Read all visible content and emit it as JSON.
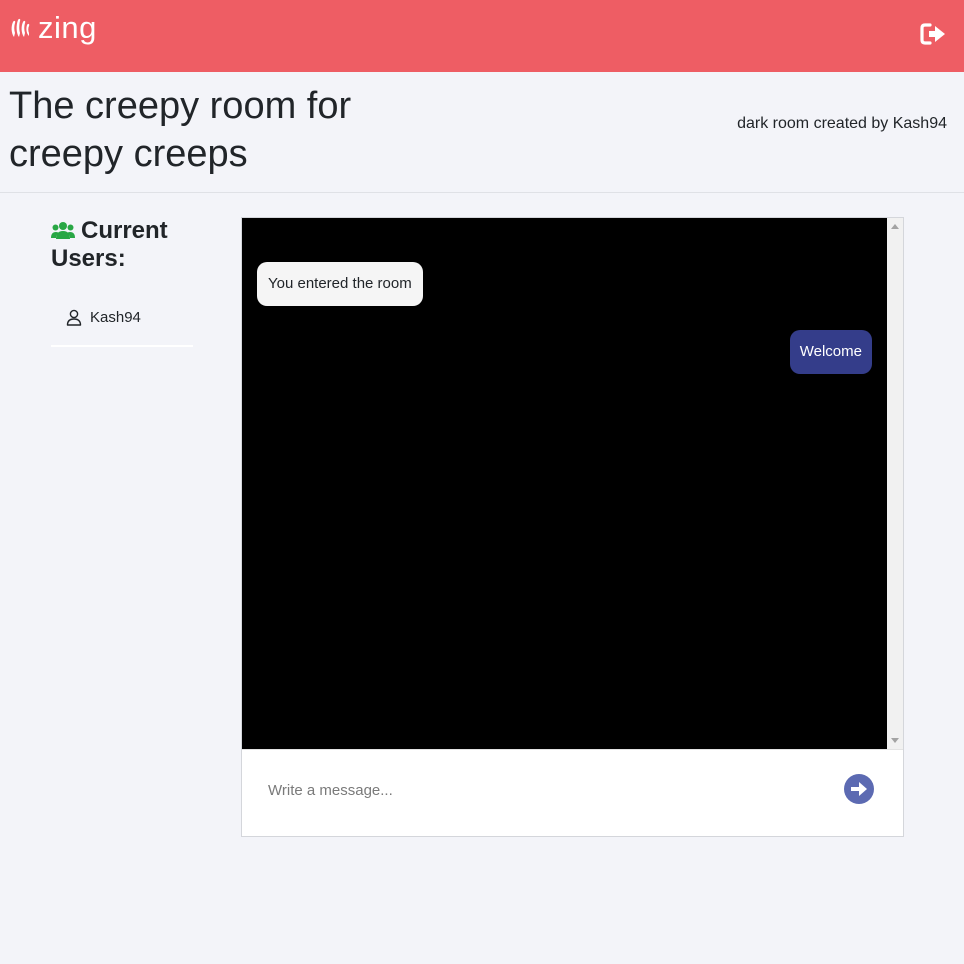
{
  "app": {
    "name": "zing"
  },
  "room": {
    "title": "The creepy room for creepy creeps",
    "theme": "dark",
    "created_by_text": "room created by",
    "creator": "Kash94"
  },
  "users_panel": {
    "heading": "Current Users:",
    "users": [
      {
        "name": "Kash94"
      }
    ]
  },
  "chat": {
    "messages": [
      {
        "direction": "incoming",
        "text": "You entered the room"
      },
      {
        "direction": "outgoing",
        "text": "Welcome"
      }
    ],
    "input_placeholder": "Write a message...",
    "input_value": ""
  },
  "colors": {
    "navbar": "#ee5d64",
    "page_background": "#f3f4f9",
    "chat_background": "#000000",
    "incoming_bubble": "#f5f5f5",
    "outgoing_bubble": "#343d8a",
    "send_button": "#5c6ab2",
    "users_icon": "#28a745"
  },
  "icons": {
    "brand": "hand-logo-icon",
    "logout": "sign-out-icon",
    "users": "users-group-icon",
    "user": "user-outline-icon",
    "send": "arrow-circle-right-icon"
  }
}
